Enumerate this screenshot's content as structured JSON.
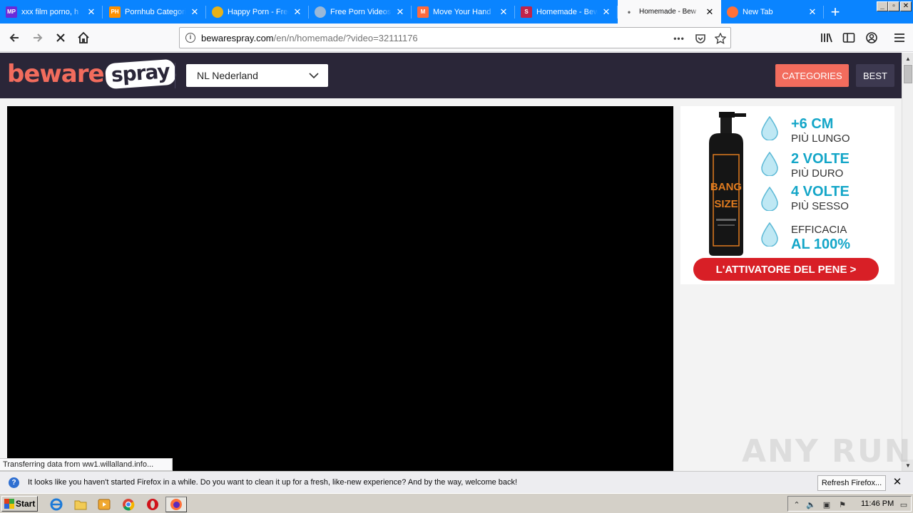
{
  "browser": {
    "tabs": [
      {
        "title": "xxx film porno, h",
        "favicon_text": "MP",
        "favicon_color": "#6a2bd9",
        "selected": false
      },
      {
        "title": "Pornhub Categori",
        "favicon_text": "PH",
        "favicon_color": "#ff9000",
        "selected": false
      },
      {
        "title": "Happy Porn - Free",
        "favicon_text": "",
        "favicon_color": "#e7b21a",
        "selected": false
      },
      {
        "title": "Free Porn Videos",
        "favicon_text": "",
        "favicon_color": "#9ab8d8",
        "selected": false
      },
      {
        "title": "Move Your Hand",
        "favicon_text": "M",
        "favicon_color": "#ff6a3d",
        "selected": false
      },
      {
        "title": "Homemade - Bew",
        "favicon_text": "S",
        "favicon_color": "#c0244a",
        "selected": false
      },
      {
        "title": "Homemade - Bew",
        "favicon_text": "•",
        "favicon_color": "",
        "selected": true
      },
      {
        "title": "New Tab",
        "favicon_text": "",
        "favicon_color": "#ff7139",
        "selected": false
      }
    ],
    "new_tab_icon": "plus-icon",
    "window_controls": {
      "minimize": "_",
      "restore": "▫",
      "close": "✕"
    },
    "url": {
      "host": "bewarespray.com",
      "path": "/en/n/homemade/?video=32111176"
    },
    "page_actions_label": "•••",
    "status_text": "Transferring data from ww1.willalland.info...",
    "accent": "#0a84ff"
  },
  "site": {
    "logo": {
      "part1": "beware",
      "part2": "spray"
    },
    "language_select": "NL Nederland",
    "categories_label": "CATEGORIES",
    "best_label": "BEST",
    "brand_color": "#f26c5d"
  },
  "ad": {
    "bottle_top": "BANG",
    "bottle_bottom": "SIZE",
    "rows": [
      {
        "big": "+6 CM",
        "small": "PIÙ LUNGO"
      },
      {
        "big": "2 VOLTE",
        "small": "PIÙ DURO"
      },
      {
        "big": "4 VOLTE",
        "small": "PIÙ SESSO"
      },
      {
        "small": "EFFICACIA",
        "big": "AL 100%"
      }
    ],
    "cta": "L'ATTIVATORE DEL PENE >"
  },
  "watermark": "ANY RUN",
  "notification": {
    "text": "It looks like you haven't started Firefox in a while. Do you want to clean it up for a fresh, like-new experience? And by the way, welcome back!",
    "button": "Refresh Firefox..."
  },
  "taskbar": {
    "start_label": "Start",
    "apps": [
      "ie-icon",
      "folder-icon",
      "media-player-icon",
      "chrome-icon",
      "opera-icon",
      "firefox-icon"
    ],
    "clock": "11:46 PM"
  }
}
